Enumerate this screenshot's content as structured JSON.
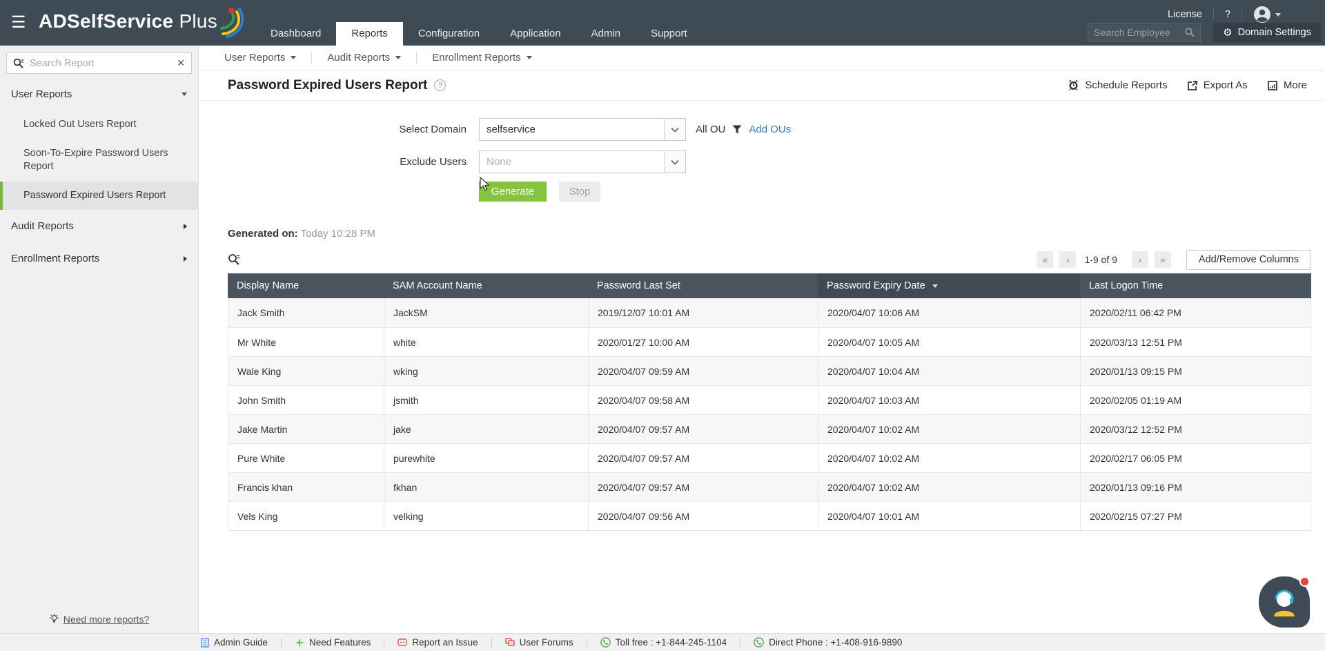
{
  "header": {
    "brand_main": "ADSelfService",
    "brand_suffix": "Plus",
    "nav": [
      {
        "label": "Dashboard"
      },
      {
        "label": "Reports"
      },
      {
        "label": "Configuration"
      },
      {
        "label": "Application"
      },
      {
        "label": "Admin"
      },
      {
        "label": "Support"
      }
    ],
    "active_tab": "Reports",
    "license_label": "License",
    "help_label": "?",
    "search_employee_placeholder": "Search Employee",
    "domain_settings_label": "Domain Settings"
  },
  "icons": {
    "menu": "☰",
    "gear": "⚙",
    "clear": "✕",
    "help": "?"
  },
  "sidebar": {
    "search_placeholder": "Search Report",
    "user_reports_label": "User Reports",
    "user_reports_items": [
      {
        "label": "Locked Out Users Report",
        "selected": false
      },
      {
        "label": "Soon-To-Expire Password Users Report",
        "selected": false
      },
      {
        "label": "Password Expired Users Report",
        "selected": true
      }
    ],
    "audit_reports_label": "Audit Reports",
    "enrollment_reports_label": "Enrollment Reports",
    "need_more_reports_label": "Need more reports?"
  },
  "subnav": [
    {
      "label": "User Reports"
    },
    {
      "label": "Audit Reports"
    },
    {
      "label": "Enrollment Reports"
    }
  ],
  "page": {
    "title": "Password Expired Users Report",
    "actions": {
      "schedule": "Schedule Reports",
      "export": "Export As",
      "more": "More"
    }
  },
  "form": {
    "select_domain_label": "Select Domain",
    "select_domain_value": "selfservice",
    "all_ou_label": "All OU",
    "add_ous_label": "Add OUs",
    "exclude_users_label": "Exclude Users",
    "exclude_users_placeholder": "None",
    "generate_label": "Generate",
    "stop_label": "Stop"
  },
  "generated": {
    "label": "Generated on:",
    "value": "Today 10:28 PM"
  },
  "table": {
    "pagination": {
      "first": "«",
      "prev": "‹",
      "range": "1-9 of 9",
      "next": "›",
      "last": "»"
    },
    "add_remove_columns_label": "Add/Remove Columns",
    "columns": [
      {
        "label": "Display Name"
      },
      {
        "label": "SAM Account Name"
      },
      {
        "label": "Password Last Set"
      },
      {
        "label": "Password Expiry Date",
        "sorted": "desc"
      },
      {
        "label": "Last Logon Time"
      }
    ],
    "rows": [
      {
        "display": "Jack Smith",
        "sam": "JackSM",
        "last_set": "2019/12/07 10:01 AM",
        "expiry": "2020/04/07 10:06 AM",
        "logon": "2020/02/11 06:42 PM"
      },
      {
        "display": "Mr White",
        "sam": "white",
        "last_set": "2020/01/27 10:00 AM",
        "expiry": "2020/04/07 10:05 AM",
        "logon": "2020/03/13 12:51 PM"
      },
      {
        "display": "Wale King",
        "sam": "wking",
        "last_set": "2020/04/07 09:59 AM",
        "expiry": "2020/04/07 10:04 AM",
        "logon": "2020/01/13 09:15 PM"
      },
      {
        "display": "John Smith",
        "sam": "jsmith",
        "last_set": "2020/04/07 09:58 AM",
        "expiry": "2020/04/07 10:03 AM",
        "logon": "2020/02/05 01:19 AM"
      },
      {
        "display": "Jake Martin",
        "sam": "jake",
        "last_set": "2020/04/07 09:57 AM",
        "expiry": "2020/04/07 10:02 AM",
        "logon": "2020/03/12 12:52 PM"
      },
      {
        "display": "Pure White",
        "sam": "purewhite",
        "last_set": "2020/04/07 09:57 AM",
        "expiry": "2020/04/07 10:02 AM",
        "logon": "2020/02/17 06:05 PM"
      },
      {
        "display": "Francis khan",
        "sam": "fkhan",
        "last_set": "2020/04/07 09:57 AM",
        "expiry": "2020/04/07 10:02 AM",
        "logon": "2020/01/13 09:16 PM"
      },
      {
        "display": "Vels King",
        "sam": "velking",
        "last_set": "2020/04/07 09:56 AM",
        "expiry": "2020/04/07 10:01 AM",
        "logon": "2020/02/15 07:27 PM"
      }
    ]
  },
  "footer": {
    "links": [
      {
        "label": "Admin Guide"
      },
      {
        "label": "Need Features"
      },
      {
        "label": "Report an Issue"
      },
      {
        "label": "User Forums"
      },
      {
        "label": "Toll free : +1-844-245-1104"
      },
      {
        "label": "Direct Phone : +1-408-916-9890"
      }
    ]
  },
  "colors": {
    "header_bg": "#3e4a54",
    "accent_green": "#86c440",
    "link_blue": "#2e7bbf",
    "table_header_bg": "#4a545e",
    "table_header_sorted_bg": "#3f4a54",
    "sidebar_selected_border": "#7db343"
  }
}
